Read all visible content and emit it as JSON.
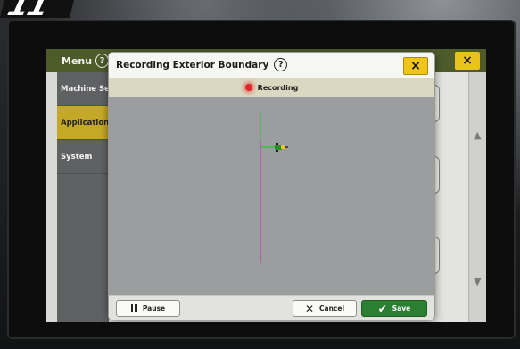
{
  "badge": {
    "number": "11"
  },
  "menu": {
    "title": "Menu",
    "help_glyph": "?",
    "items": [
      {
        "label": "Machine Setti",
        "active": false
      },
      {
        "label": "Applications",
        "active": true
      },
      {
        "label": "System",
        "active": false
      }
    ]
  },
  "app": {
    "close_glyph": "×",
    "scroll_up": "▲",
    "scroll_down": "▼"
  },
  "dialog": {
    "title": "Recording Exterior Boundary",
    "help_glyph": "?",
    "close_glyph": "×",
    "status": {
      "label": "Recording",
      "indicator_color": "#e3262a"
    },
    "buttons": {
      "pause": "Pause",
      "cancel": "Cancel",
      "save": "Save"
    }
  },
  "colors": {
    "header_green": "#4d5a2a",
    "accent_yellow": "#f0c419",
    "save_green": "#2a7f33",
    "map_gray": "#9c9d9f",
    "boundary_line": "#b243b8",
    "track_line": "#35c241"
  },
  "icons": {
    "pause": "pause-icon",
    "cancel": "close-icon",
    "save": "check-icon",
    "vehicle": "tractor-icon"
  }
}
